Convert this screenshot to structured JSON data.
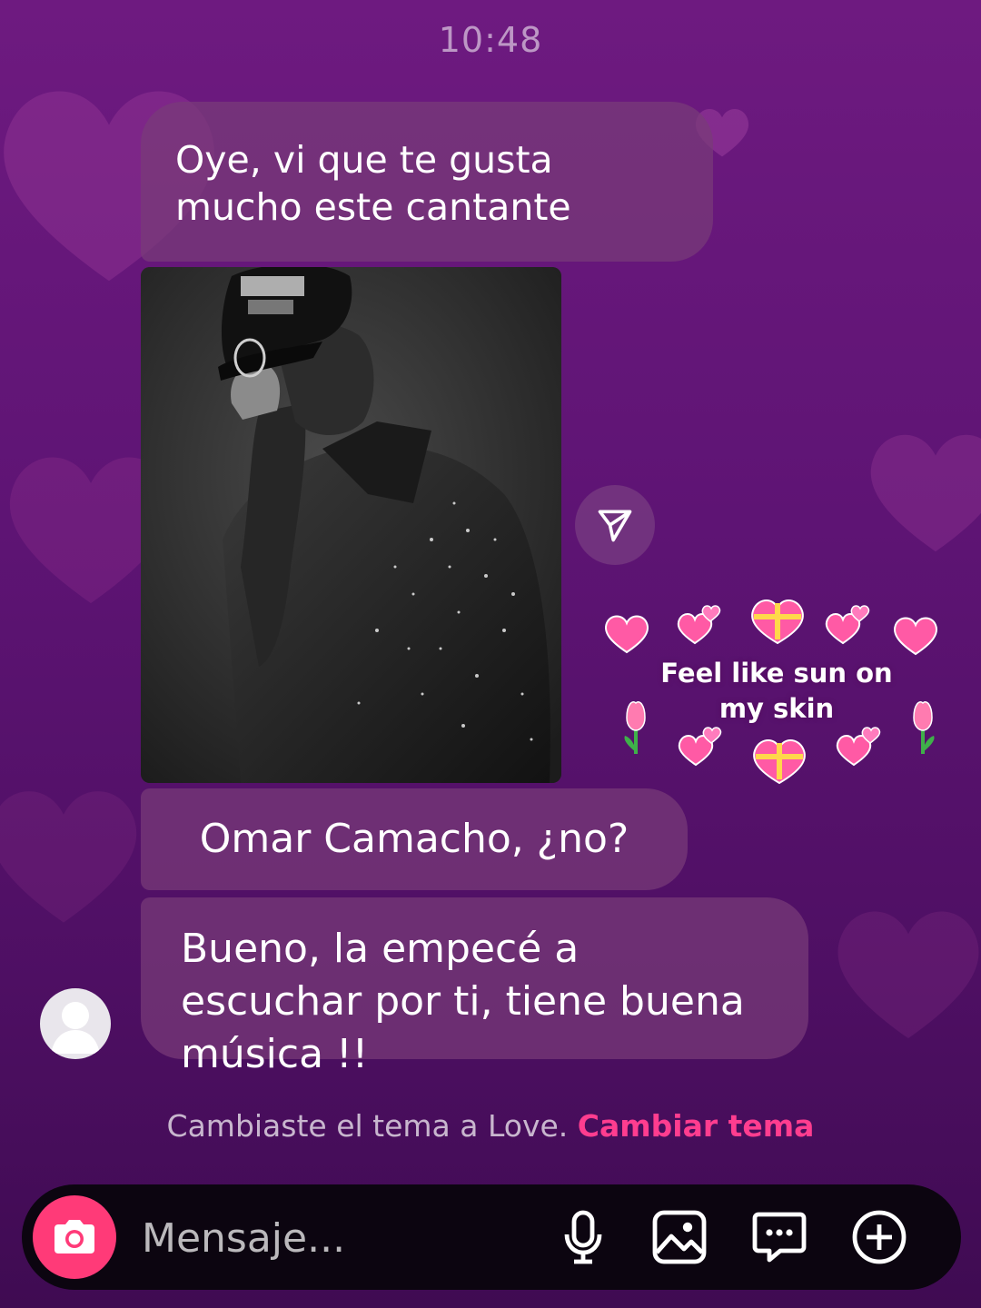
{
  "status": {
    "time": "10:48"
  },
  "messages": [
    {
      "text": "Oye, vi que te gusta mucho este cantante"
    },
    {
      "text": "Omar Camacho, ¿no?"
    },
    {
      "text": "Bueno, la empecé a escuchar por ti, tiene buena música !!"
    }
  ],
  "sticker": {
    "text": "Feel like sun on my skin"
  },
  "theme_notice": {
    "text": "Cambiaste el tema a Love.",
    "link": "Cambiar tema"
  },
  "composer": {
    "placeholder": "Mensaje..."
  },
  "icons": {
    "share": "paper-plane-icon",
    "camera": "camera-icon",
    "mic": "microphone-icon",
    "gallery": "image-icon",
    "sticker": "chat-sticker-icon",
    "more": "plus-circle-icon"
  },
  "colors": {
    "accent": "#ff3a78",
    "link": "#ff3d8f",
    "bubble": "#7a3c7a"
  }
}
